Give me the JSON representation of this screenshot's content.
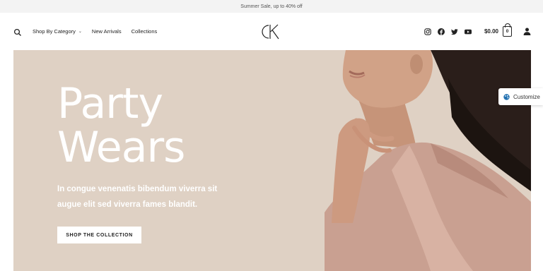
{
  "announcement": "Summer Sale, up to 40% off",
  "nav": {
    "items": [
      {
        "label": "Shop By Category",
        "has_dropdown": true
      },
      {
        "label": "New Arrivals"
      },
      {
        "label": "Collections"
      }
    ]
  },
  "logo": {
    "text": "CK"
  },
  "header_right": {
    "social": [
      "instagram-icon",
      "facebook-icon",
      "twitter-icon",
      "youtube-icon"
    ],
    "cart_total": "$0.00",
    "cart_count": "0"
  },
  "hero": {
    "title_line1": "Party",
    "title_line2": "Wears",
    "text_line1": "In congue venenatis bibendum viverra sit",
    "text_line2": "augue elit sed viverra fames blandit.",
    "button_label": "SHOP THE COLLECTION"
  },
  "customize": {
    "label": "Customize"
  },
  "colors": {
    "hero_bg": "#dfd1c4",
    "accent_blue": "#2271b1",
    "text_dark": "#222222"
  }
}
